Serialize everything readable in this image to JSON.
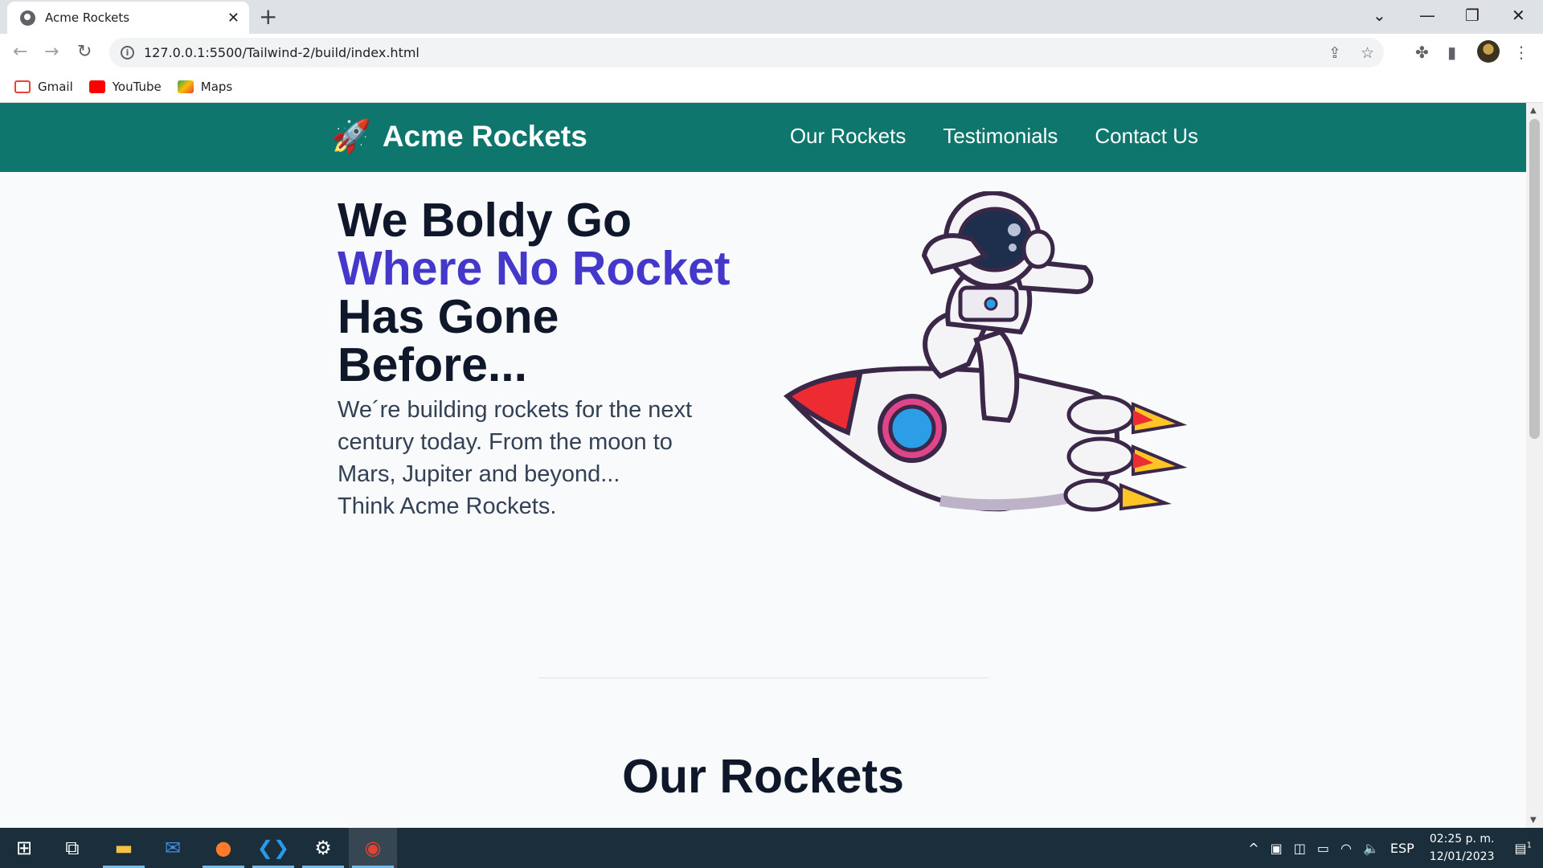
{
  "browser": {
    "tab_title": "Acme Rockets",
    "url": "127.0.0.1:5500/Tailwind-2/build/index.html",
    "bookmarks": [
      {
        "label": "Gmail",
        "icon": "gmail-icon",
        "color": "#ea4335"
      },
      {
        "label": "YouTube",
        "icon": "youtube-icon",
        "color": "#ff0000"
      },
      {
        "label": "Maps",
        "icon": "maps-icon",
        "color": "#34a853"
      }
    ]
  },
  "site": {
    "brand": "Acme Rockets",
    "header_color": "#0f766e",
    "accent_color": "#4338ca",
    "nav": [
      {
        "label": "Our Rockets"
      },
      {
        "label": "Testimonials"
      },
      {
        "label": "Contact Us"
      }
    ],
    "hero": {
      "title_line1": "We Boldy Go",
      "title_accent": "Where No Rocket",
      "title_line3": "Has Gone",
      "title_line4": "Before...",
      "body_lines": [
        "We´re building rockets for the next",
        "century today. From the moon to",
        "Mars, Jupiter and beyond...",
        "Think Acme Rockets."
      ]
    },
    "section_title": "Our Rockets"
  },
  "taskbar": {
    "apps": [
      "windows-start-icon",
      "task-view-icon",
      "file-explorer-icon",
      "mail-icon",
      "firefox-icon",
      "vscode-icon",
      "settings-icon",
      "chrome-icon"
    ],
    "language": "ESP",
    "time": "02:25 p. m.",
    "date": "12/01/2023",
    "notifications": "1"
  }
}
